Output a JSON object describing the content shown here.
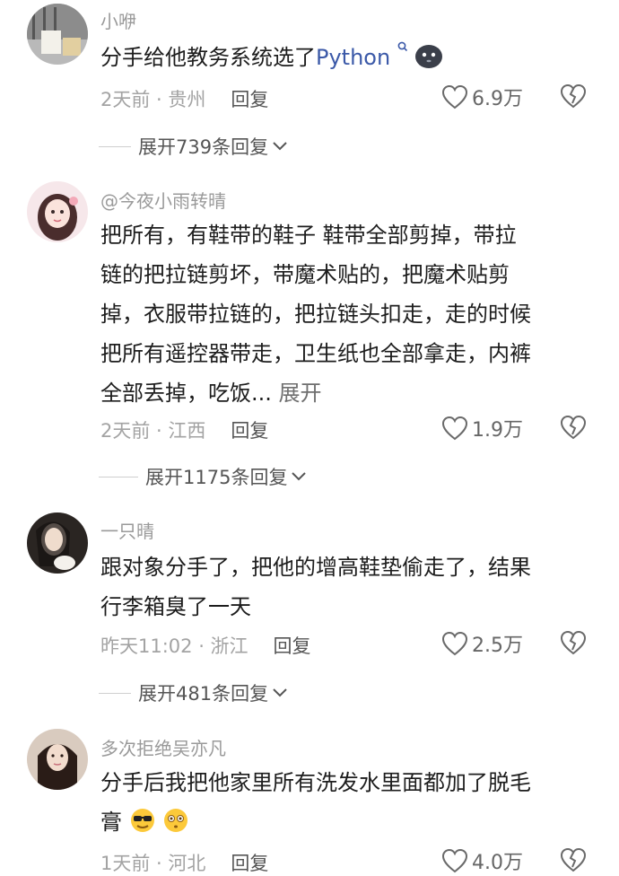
{
  "comments": [
    {
      "username": "小咿",
      "lines": [
        "分手给他教务系统选了"
      ],
      "python_word": "Python",
      "time_loc": "2天前 · 贵州",
      "reply_label": "回复",
      "likes": "6.9万",
      "expand_replies": "展开739条回复"
    },
    {
      "username": "@今夜小雨转晴",
      "lines": [
        "把所有，有鞋带的鞋子 鞋带全部剪掉，带拉",
        "链的把拉链剪坏，带魔术贴的，把魔术贴剪",
        "掉，衣服带拉链的，把拉链头扣走，走的时候",
        "把所有遥控器带走，卫生纸也全部拿走，内裤",
        "全部丢掉，吃饭..."
      ],
      "inline_expand": "展开",
      "time_loc": "2天前 · 江西",
      "reply_label": "回复",
      "likes": "1.9万",
      "expand_replies": "展开1175条回复"
    },
    {
      "username": "一只晴",
      "lines": [
        "跟对象分手了，把他的增高鞋垫偷走了，结果",
        "行李箱臭了一天"
      ],
      "time_loc": "昨天11:02 · 浙江",
      "reply_label": "回复",
      "likes": "2.5万",
      "expand_replies": "展开481条回复"
    },
    {
      "username": "多次拒绝吴亦凡",
      "lines": [
        "分手后我把他家里所有洗发水里面都加了脱毛",
        "膏"
      ],
      "time_loc": "1天前 · 河北",
      "reply_label": "回复",
      "likes": "4.0万"
    }
  ],
  "icons": {
    "like": "heart-outline-icon",
    "dislike": "broken-heart-icon",
    "chevron": "chevron-down-icon",
    "search_badge": "search-icon"
  }
}
